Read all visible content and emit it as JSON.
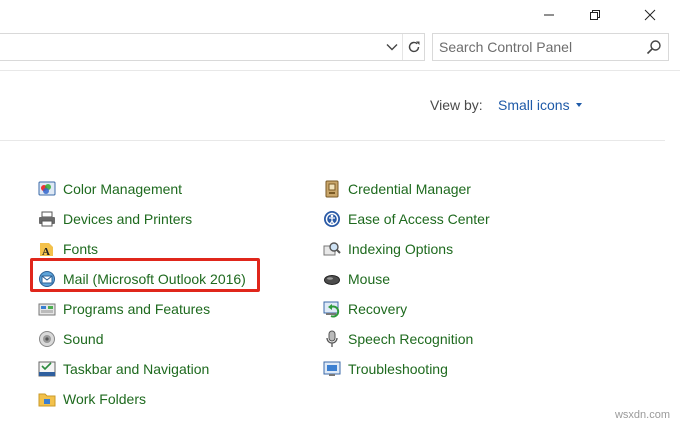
{
  "search": {
    "placeholder": "Search Control Panel"
  },
  "view_by": {
    "label": "View by:",
    "value": "Small icons"
  },
  "items_left": [
    {
      "label": "Color Management",
      "icon": "color-management-icon"
    },
    {
      "label": "Devices and Printers",
      "icon": "printer-icon"
    },
    {
      "label": "Fonts",
      "icon": "fonts-icon"
    },
    {
      "label": "Mail (Microsoft Outlook 2016)",
      "icon": "mail-icon"
    },
    {
      "label": "Programs and Features",
      "icon": "programs-icon"
    },
    {
      "label": "Sound",
      "icon": "speaker-icon"
    },
    {
      "label": "Taskbar and Navigation",
      "icon": "taskbar-icon"
    },
    {
      "label": "Work Folders",
      "icon": "folder-icon"
    }
  ],
  "items_right": [
    {
      "label": "Credential Manager",
      "icon": "credential-icon"
    },
    {
      "label": "Ease of Access Center",
      "icon": "ease-of-access-icon"
    },
    {
      "label": "Indexing Options",
      "icon": "indexing-icon"
    },
    {
      "label": "Mouse",
      "icon": "mouse-icon"
    },
    {
      "label": "Recovery",
      "icon": "recovery-icon"
    },
    {
      "label": "Speech Recognition",
      "icon": "microphone-icon"
    },
    {
      "label": "Troubleshooting",
      "icon": "troubleshooting-icon"
    }
  ],
  "watermark": "wsxdn.com",
  "colors": {
    "link": "#1e6a1e",
    "accent": "#1e5aa8",
    "highlight": "#e0261b"
  }
}
